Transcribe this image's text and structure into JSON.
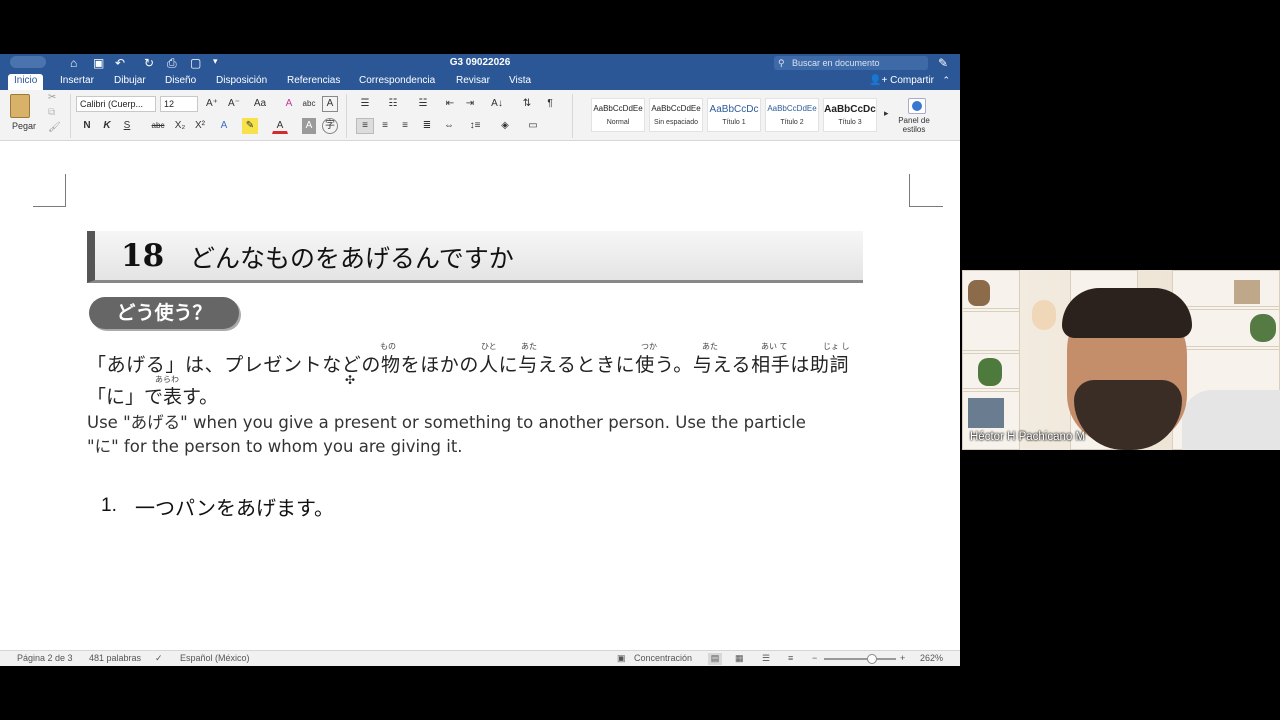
{
  "window": {
    "document_title": "G3 09022026",
    "search_placeholder": "Buscar en documento",
    "share_label": "Compartir"
  },
  "tabs": [
    "Inicio",
    "Insertar",
    "Dibujar",
    "Diseño",
    "Disposición",
    "Referencias",
    "Correspondencia",
    "Revisar",
    "Vista"
  ],
  "ribbon": {
    "paste_label": "Pegar",
    "font_name": "Calibri (Cuerp...",
    "font_size": "12",
    "bold": "N",
    "italic": "K",
    "underline": "S",
    "strike": "abc",
    "subscript": "X₂",
    "superscript": "X²",
    "styles": [
      {
        "sample": "AaBbCcDdEe",
        "name": "Normal"
      },
      {
        "sample": "AaBbCcDdEe",
        "name": "Sin espaciado"
      },
      {
        "sample": "AaBbCcDc",
        "name": "Título 1"
      },
      {
        "sample": "AaBbCcDdEe",
        "name": "Título 2"
      },
      {
        "sample": "AaBbCcDc",
        "name": "Título 3"
      }
    ],
    "styles_pane_label_1": "Panel de",
    "styles_pane_label_2": "estilos"
  },
  "document": {
    "lesson_number": "18",
    "lesson_title": "どんなものをあげるんですか",
    "section_pill": "どう使う？",
    "jp_line1": "「あげる」は、プレゼントなどの物をほかの人に与えるときに使う。与える相手は助詞",
    "jp_line2": "「に」で表す。",
    "ruby": {
      "mono": "もの",
      "hito": "ひと",
      "ata": "あた",
      "tsuka": "つか",
      "ata2": "あた",
      "aite": "あい て",
      "joshi": "じょ し",
      "arawa": "あらわ"
    },
    "en_line1": "Use \"あげる\" when you give a present or something to another person. Use the particle",
    "en_line2": "\"に\" for the person to whom you are giving it.",
    "list_number": "1.",
    "list_text": "一つパンをあげます。"
  },
  "status": {
    "page": "Página 2 de 3",
    "words": "481 palabras",
    "language": "Español (México)",
    "focus": "Concentración",
    "zoom": "262%",
    "zoom_fraction": 0.66
  },
  "video": {
    "participant_name": "Héctor H Pachicano M"
  }
}
